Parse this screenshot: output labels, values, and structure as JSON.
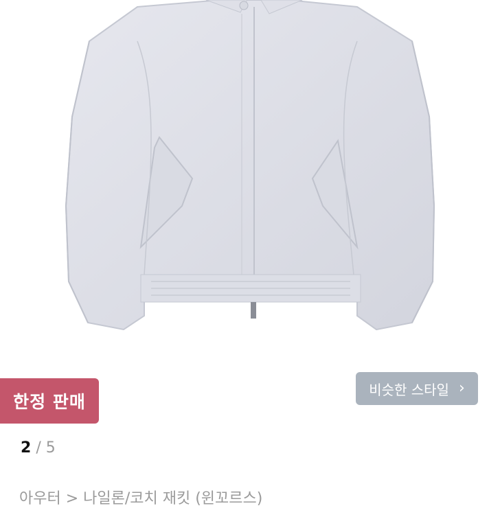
{
  "product_image": {
    "alt": "product-photo",
    "background": "#ffffff"
  },
  "badge": {
    "label": "한정 판매",
    "color": "#c4566b"
  },
  "similar_style": {
    "label": "비슷한 스타일",
    "icon": "chevron-right-icon",
    "color": "#aab3bd"
  },
  "pager": {
    "current": "2",
    "separator": "/",
    "total": "5"
  },
  "breadcrumb": {
    "text": "아우터 > 나일론/코치 재킷 (윈꼬르스)"
  }
}
